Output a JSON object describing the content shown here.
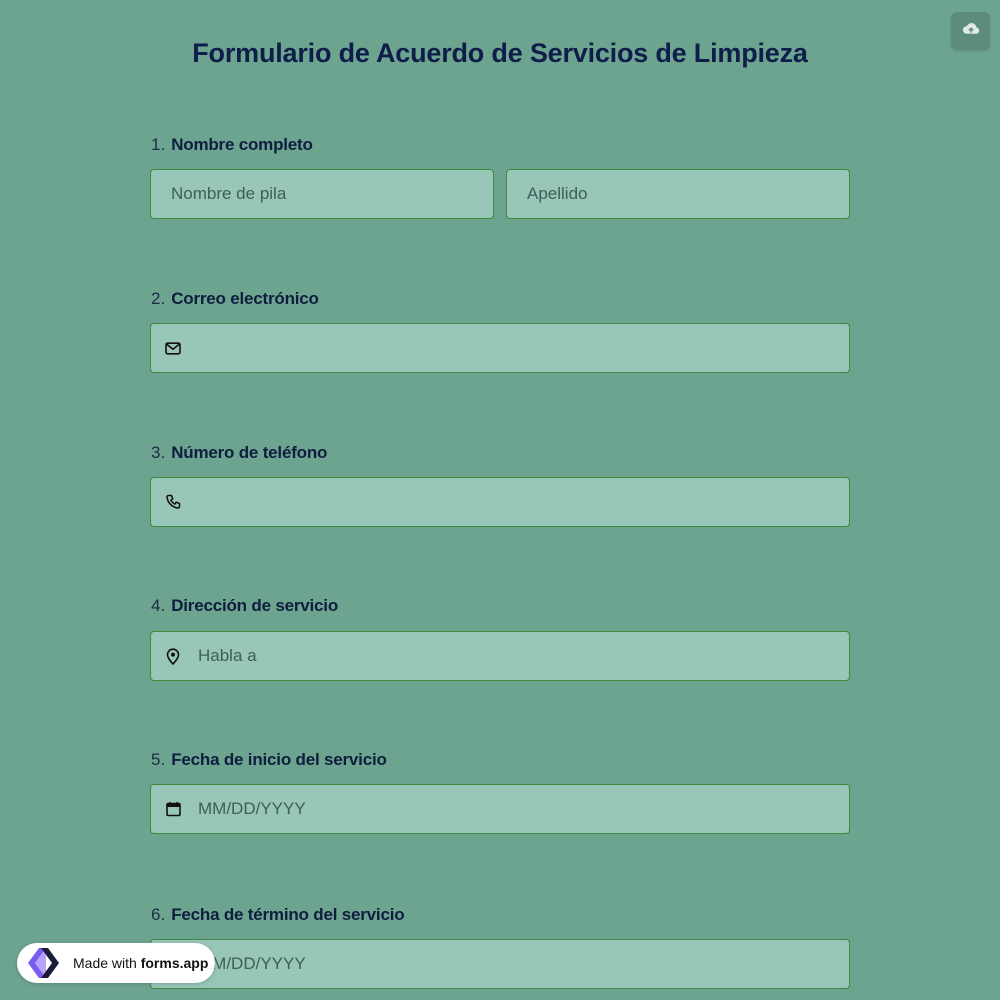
{
  "form": {
    "title": "Formulario de Acuerdo de Servicios de Limpieza",
    "questions": [
      {
        "number": "1.",
        "label": "Nombre completo",
        "fields": [
          {
            "placeholder": "Nombre de pila"
          },
          {
            "placeholder": "Apellido"
          }
        ]
      },
      {
        "number": "2.",
        "label": "Correo electrónico",
        "icon": "envelope-icon",
        "placeholder": ""
      },
      {
        "number": "3.",
        "label": "Número de teléfono",
        "icon": "phone-icon",
        "placeholder": ""
      },
      {
        "number": "4.",
        "label": "Dirección de servicio",
        "icon": "location-pin-icon",
        "placeholder": "Habla a"
      },
      {
        "number": "5.",
        "label": "Fecha de inicio del servicio",
        "icon": "calendar-icon",
        "placeholder": "MM/DD/YYYY"
      },
      {
        "number": "6.",
        "label": "Fecha de término del servicio",
        "icon": "calendar-icon",
        "placeholder": "MM/DD/YYYY"
      }
    ]
  },
  "toolbar": {
    "save_icon": "cloud-upload-icon"
  },
  "badge": {
    "prefix": "Made with",
    "brand": "forms.app"
  },
  "colors": {
    "background": "#6da48f",
    "field_bg": "#98c6b9",
    "field_border": "#3f8a3a",
    "text": "#0f1d3f"
  }
}
